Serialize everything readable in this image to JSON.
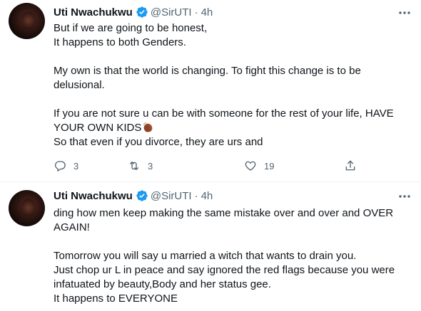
{
  "tweets": [
    {
      "author_name": "Uti Nwachukwu",
      "handle": "@SirUTI",
      "separator": "·",
      "time": "4h",
      "lines": [
        "But if we are going to be honest,",
        "It happens to both Genders.",
        "",
        "My own is that the world is changing. To fight this change is to be",
        "delusional.",
        "",
        "If you are not sure u can be with someone for the rest of your life, HAVE",
        "YOUR OWN KIDS",
        "So that even if you divorce, they are urs and"
      ],
      "emoji": "clapping-hands-emoji",
      "replies": "3",
      "retweets": "3",
      "likes": "19"
    },
    {
      "author_name": "Uti Nwachukwu",
      "handle": "@SirUTI",
      "separator": "·",
      "time": "4h",
      "lines": [
        "ding how men keep making the same mistake over and over and OVER",
        "AGAIN!",
        "",
        "Tomorrow you will say u married a witch that wants to drain you.",
        "Just chop ur L in peace and say ignored the red flags because you were",
        "infatuated by beauty,Body and her status gee.",
        "It happens to EVERYONE"
      ]
    }
  ],
  "colors": {
    "verified": "#1d9bf0",
    "muted": "#536471",
    "text": "#0f1419"
  }
}
